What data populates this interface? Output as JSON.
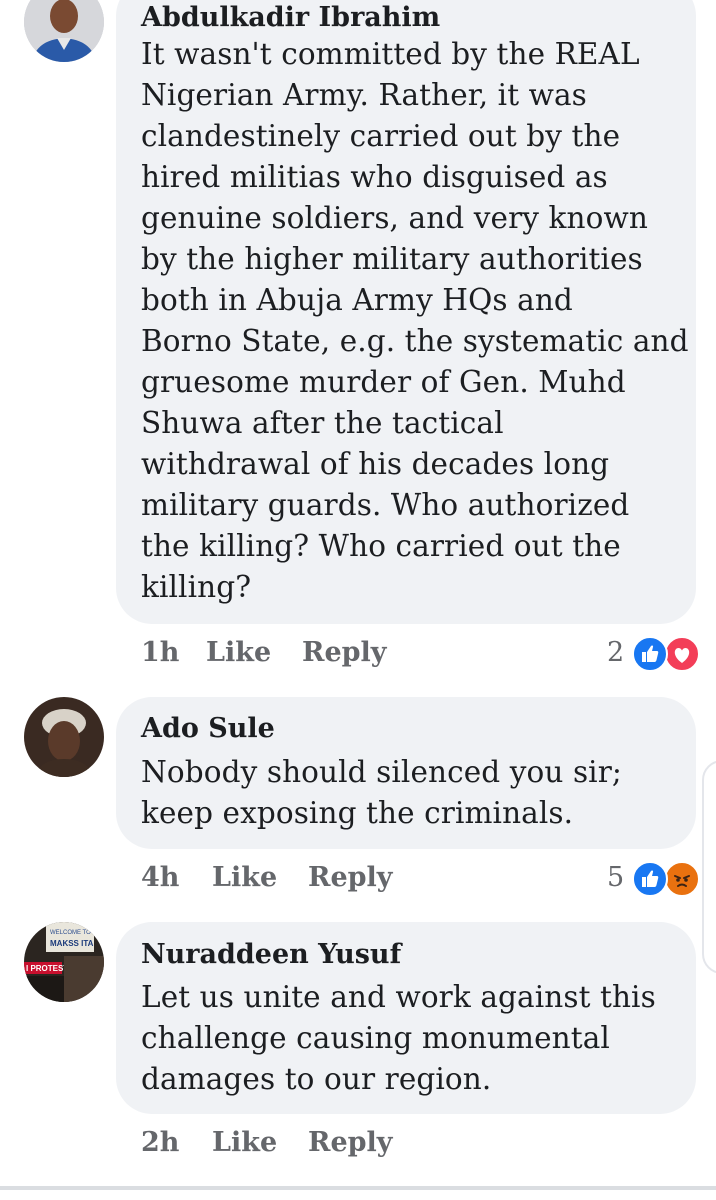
{
  "comments": [
    {
      "author": "Abdulkadir Ibrahim",
      "lines": [
        "It wasn't committed by the REAL",
        "Nigerian Army. Rather, it was",
        "clandestinely carried out by the",
        "hired militias who disguised as",
        "genuine soldiers, and very known",
        "by the higher military authorities",
        "both in Abuja Army HQs and",
        "Borno State, e.g. the systematic and",
        "gruesome murder of Gen. Muhd",
        "Shuwa after the tactical",
        "withdrawal of his decades long",
        "military guards. Who authorized",
        "the killing? Who carried out the",
        "killing?"
      ],
      "time": "1h",
      "like_label": "Like",
      "reply_label": "Reply",
      "reaction_count": "2",
      "reactions": [
        "like-icon",
        "love-icon"
      ]
    },
    {
      "author": "Ado Sule",
      "lines": [
        "Nobody should silenced you sir;",
        "keep exposing the criminals."
      ],
      "time": "4h",
      "like_label": "Like",
      "reply_label": "Reply",
      "reaction_count": "5",
      "reactions": [
        "like-icon",
        "angry-icon"
      ]
    },
    {
      "author": "Nuraddeen Yusuf",
      "lines": [
        "Let us unite and work against this",
        "challenge causing monumental",
        "damages to our region."
      ],
      "time": "2h",
      "like_label": "Like",
      "reply_label": "Reply"
    }
  ],
  "avatar3_image": {
    "sign_line1": "WELCOME TO",
    "sign_line2": "MAKSS ITA",
    "protest_label": "I PROTEST"
  },
  "colors": {
    "bubble": "#f0f2f5",
    "meta_text": "#65676b",
    "like_blue": "#1877f2",
    "love_red": "#f33e58",
    "angry_orange": "#e9710f"
  }
}
